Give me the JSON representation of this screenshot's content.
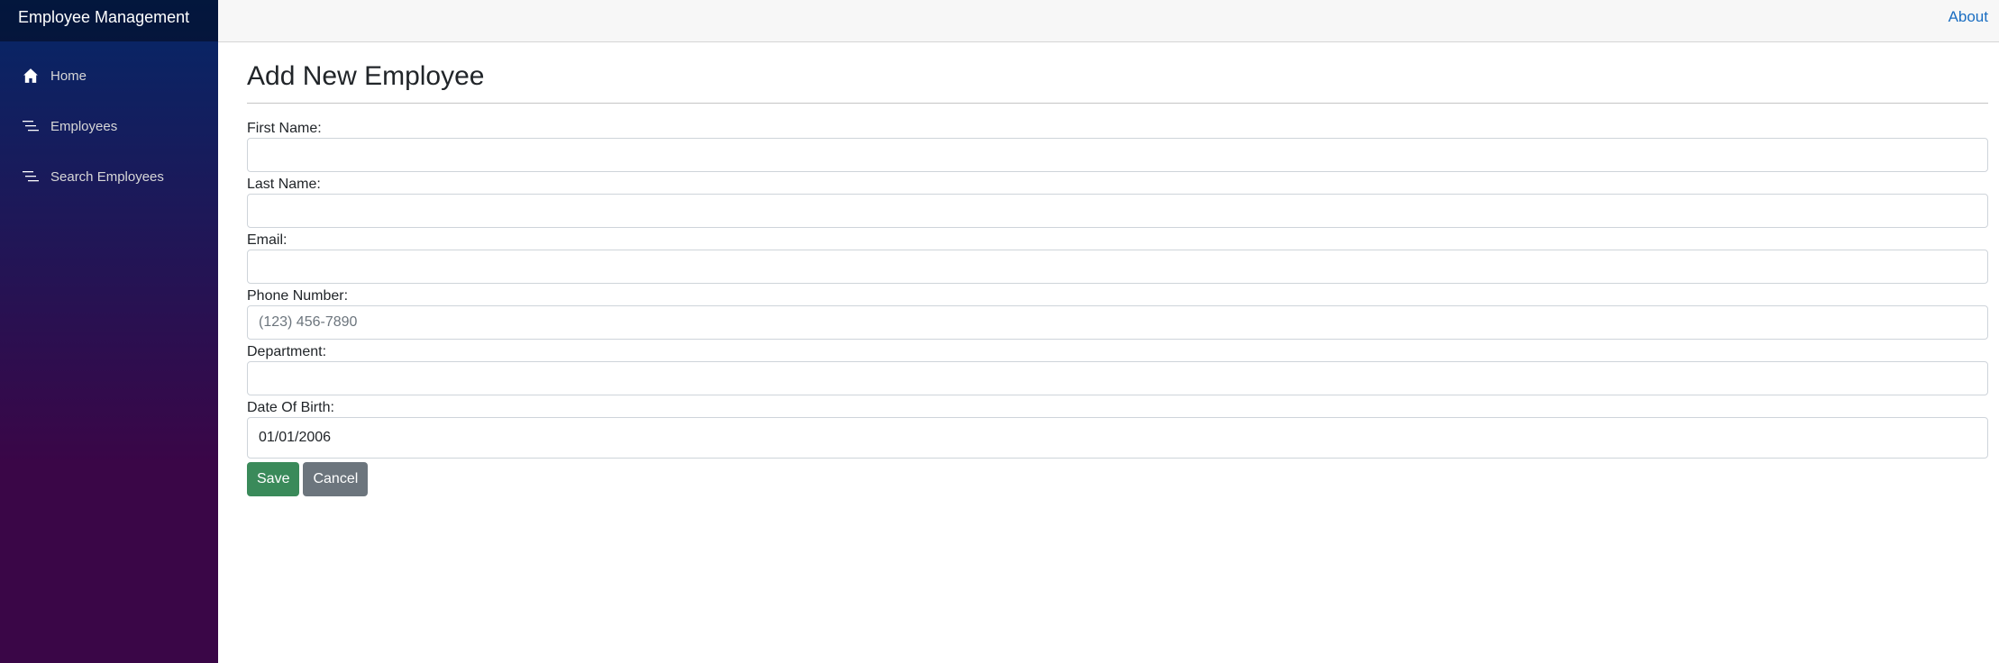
{
  "app": {
    "brand": "Employee Management"
  },
  "sidebar": {
    "items": [
      {
        "label": "Home",
        "icon": "home-icon"
      },
      {
        "label": "Employees",
        "icon": "list-icon"
      },
      {
        "label": "Search Employees",
        "icon": "list-icon"
      }
    ]
  },
  "topbar": {
    "about_label": "About"
  },
  "form": {
    "title": "Add New Employee",
    "fields": {
      "first_name": {
        "label": "First Name:",
        "value": "",
        "placeholder": ""
      },
      "last_name": {
        "label": "Last Name:",
        "value": "",
        "placeholder": ""
      },
      "email": {
        "label": "Email:",
        "value": "",
        "placeholder": ""
      },
      "phone": {
        "label": "Phone Number:",
        "value": "",
        "placeholder": "(123) 456-7890"
      },
      "department": {
        "label": "Department:",
        "value": "",
        "placeholder": ""
      },
      "dob": {
        "label": "Date Of Birth:",
        "value": "01/01/2006"
      }
    },
    "save_label": "Save",
    "cancel_label": "Cancel"
  },
  "colors": {
    "sidebar_gradient_top": "#052767",
    "sidebar_gradient_bottom": "#3a0647",
    "save_button": "#3a8a5a",
    "cancel_button": "#6c757d",
    "link": "#1b6ec2"
  }
}
